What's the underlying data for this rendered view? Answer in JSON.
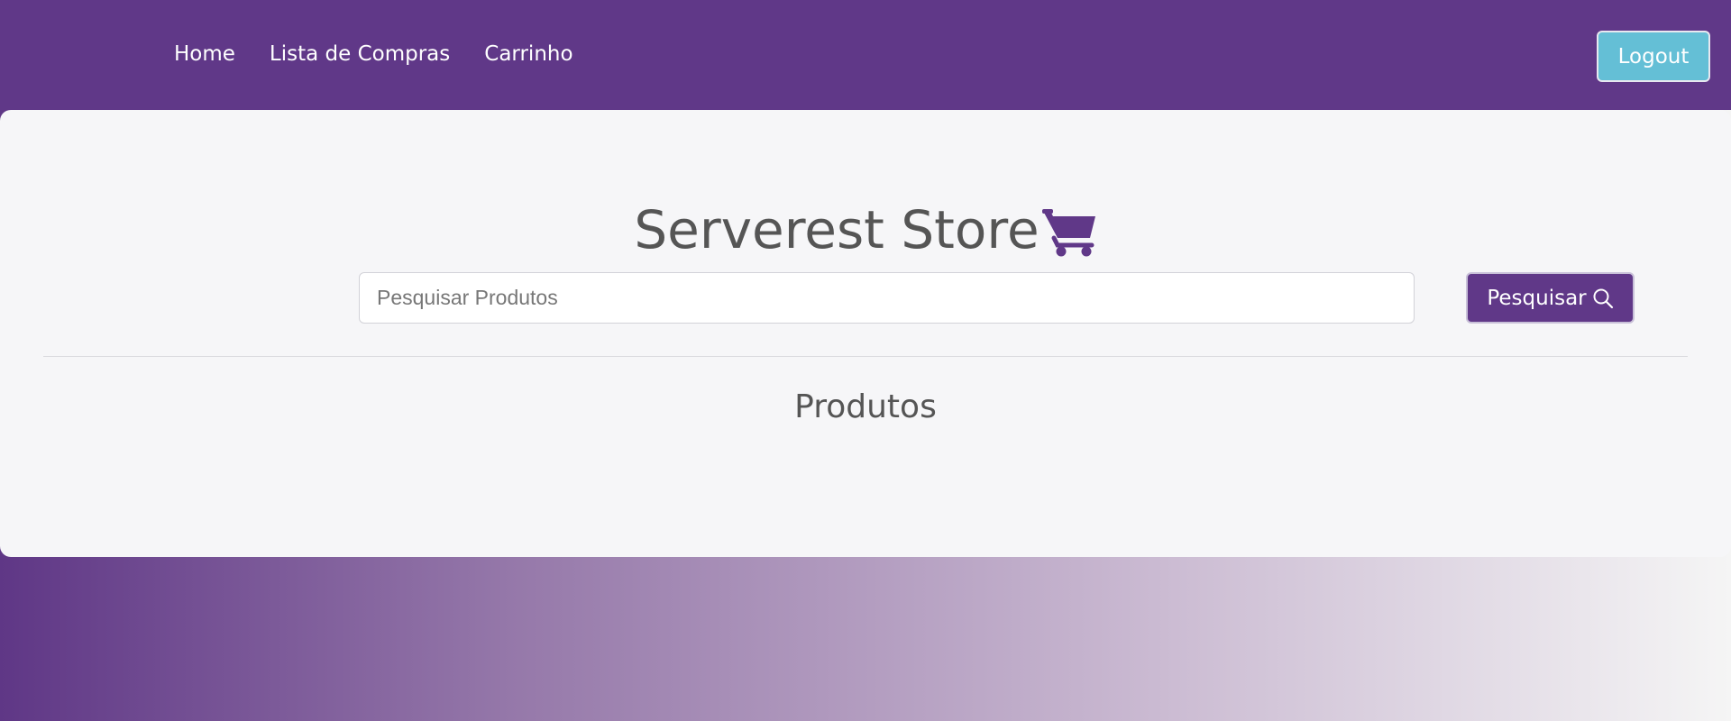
{
  "navbar": {
    "links": [
      {
        "label": "Home"
      },
      {
        "label": "Lista de Compras"
      },
      {
        "label": "Carrinho"
      }
    ],
    "logout_label": "Logout"
  },
  "main": {
    "title": "Serverest Store",
    "title_icon": "shopping-cart-icon",
    "search": {
      "placeholder": "Pesquisar Produtos",
      "value": "",
      "button_label": "Pesquisar",
      "button_icon": "search-icon"
    },
    "section_title": "Produtos"
  },
  "colors": {
    "brand_purple": "#603888",
    "logout_cyan": "#64bfd6",
    "card_background": "#f6f6f8",
    "title_text": "#555555"
  }
}
